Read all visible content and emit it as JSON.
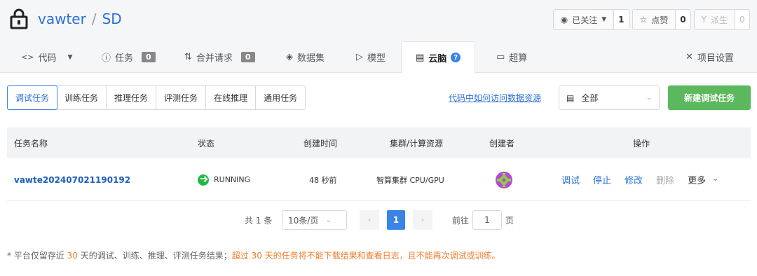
{
  "header": {
    "owner": "vawter",
    "separator": "/",
    "repo": "SD",
    "actions": [
      {
        "label": "已关注",
        "icon": "eye-icon",
        "count": "1"
      },
      {
        "label": "点赞",
        "icon": "star-icon",
        "count": "0"
      },
      {
        "label": "派生",
        "icon": "fork-icon",
        "count": "0"
      }
    ],
    "tabs": [
      {
        "label": "代码",
        "icon": "code-icon"
      },
      {
        "label": "任务",
        "icon": "issue-icon",
        "count": "0"
      },
      {
        "label": "合并请求",
        "icon": "pull-request-icon",
        "count": "0"
      },
      {
        "label": "数据集",
        "icon": "dataset-icon"
      },
      {
        "label": "模型",
        "icon": "model-icon"
      },
      {
        "label": "云脑",
        "icon": "cloudbrain-icon",
        "help": "?"
      },
      {
        "label": "超算",
        "icon": "supercomputer-icon"
      },
      {
        "label": "项目设置",
        "icon": "settings-icon"
      }
    ]
  },
  "filters": {
    "segments": [
      "调试任务",
      "训练任务",
      "推理任务",
      "评测任务",
      "在线推理",
      "通用任务"
    ],
    "help_link": "代码中如何访问数据资源",
    "select_value": "全部",
    "new_button": "新建调试任务"
  },
  "table": {
    "columns": [
      "任务名称",
      "状态",
      "创建时间",
      "集群/计算资源",
      "创建者",
      "操作"
    ],
    "rows": [
      {
        "name": "vawte20240702119019​2",
        "status": "RUNNING",
        "created": "48 秒前",
        "resource": "智算集群 CPU/GPU",
        "ops": [
          "调试",
          "停止",
          "修改",
          "删除",
          "更多"
        ]
      }
    ]
  },
  "pager": {
    "total": "共 1 条",
    "page_size": "10条/页",
    "current": "1",
    "goto_label": "前往",
    "goto_value": "1",
    "page_suffix": "页"
  },
  "note": {
    "part1": "* 平台仅留存近 ",
    "days1": "30",
    "part2": " 天的调试、训练、推理、评测任务结果；",
    "warn": "超过 30 天的任务将不能下载结果和查看日志，且不能再次调试或训练。"
  },
  "colors": {
    "accent": "#2a6fd6",
    "primary_button": "#5cb85c",
    "running": "#21ba45",
    "warning": "#f07c2a"
  }
}
